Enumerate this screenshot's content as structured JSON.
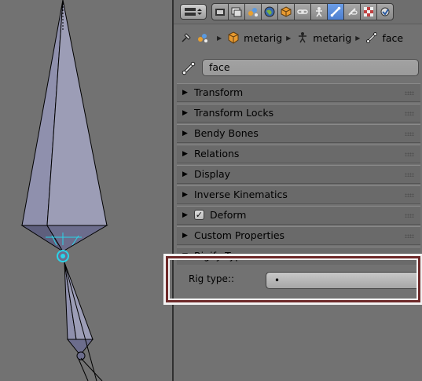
{
  "properties_header": {
    "editor_type_icon": "editor-type-icon",
    "tabs": [
      {
        "icon": "render-icon",
        "active": false
      },
      {
        "icon": "render-layers-icon",
        "active": false
      },
      {
        "icon": "scene-icon",
        "active": false
      },
      {
        "icon": "world-icon",
        "active": false
      },
      {
        "icon": "object-icon",
        "active": false
      },
      {
        "icon": "constraints-icon",
        "active": false
      },
      {
        "icon": "armature-data-icon",
        "active": false
      },
      {
        "icon": "bone-icon",
        "active": true
      },
      {
        "icon": "bone-constraints-icon",
        "active": false
      },
      {
        "icon": "texture-icon",
        "active": false
      },
      {
        "icon": "particles-icon",
        "active": false
      }
    ]
  },
  "breadcrumb": {
    "items": [
      {
        "icon": "pin-icon",
        "label": ""
      },
      {
        "icon": "scene-icon",
        "label": ""
      },
      {
        "icon": "object-cube-icon",
        "label": "metarig"
      },
      {
        "icon": "armature-icon",
        "label": "metarig"
      },
      {
        "icon": "bone-icon",
        "label": "face"
      }
    ]
  },
  "bone_name": {
    "icon": "bone-icon",
    "value": "face"
  },
  "sections": [
    {
      "label": "Transform",
      "expanded": false
    },
    {
      "label": "Transform Locks",
      "expanded": false
    },
    {
      "label": "Bendy Bones",
      "expanded": false
    },
    {
      "label": "Relations",
      "expanded": false
    },
    {
      "label": "Display",
      "expanded": false
    },
    {
      "label": "Inverse Kinematics",
      "expanded": false
    },
    {
      "label": "Deform",
      "expanded": false,
      "checkbox": true
    },
    {
      "label": "Custom Properties",
      "expanded": false
    },
    {
      "label": "Rigify Type",
      "expanded": true
    }
  ],
  "rigify": {
    "label": "Rig type::",
    "value": "•"
  },
  "colors": {
    "highlight_border": "#6e2a2a",
    "active_tab": "#5a8ad8",
    "bone_select": "#2ad4e8"
  }
}
